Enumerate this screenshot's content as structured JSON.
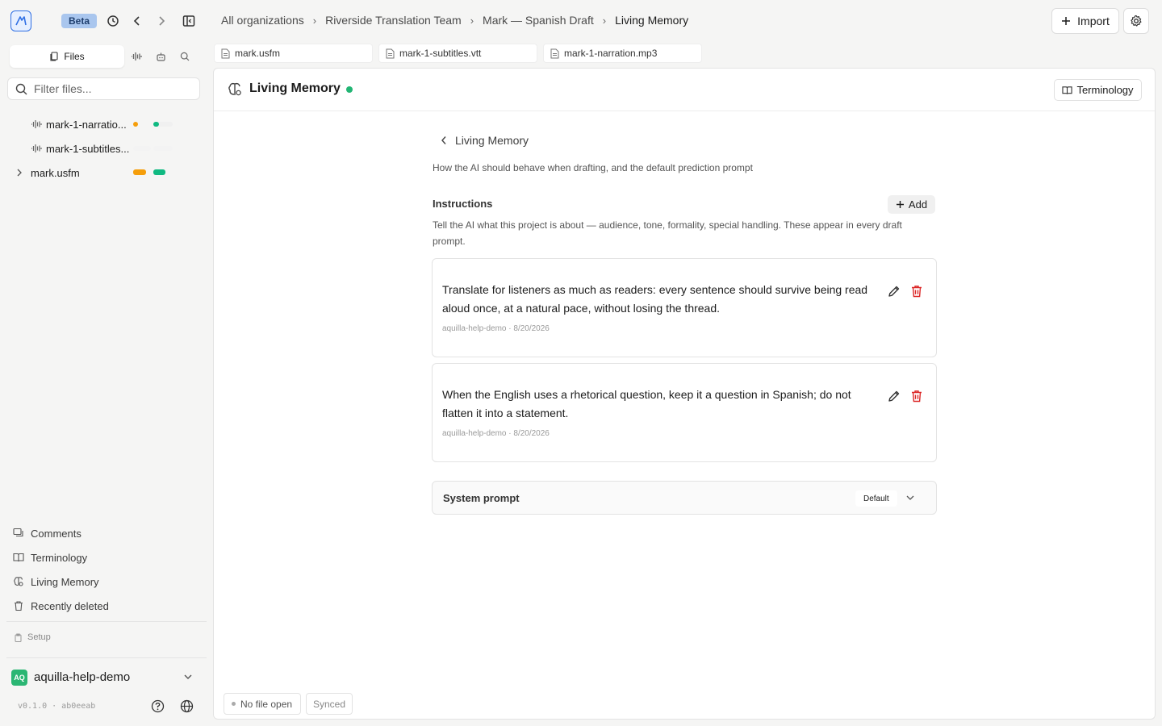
{
  "topbar": {
    "beta_label": "Beta",
    "breadcrumbs": [
      "All organizations",
      "Riverside Translation Team",
      "Mark — Spanish Draft",
      "Living Memory"
    ],
    "import_label": "Import"
  },
  "sidebar": {
    "tab_files": "Files",
    "filter_placeholder": "Filter files...",
    "files": [
      {
        "name": "mark-1-narratio...",
        "icon": "waveform-icon"
      },
      {
        "name": "mark-1-subtitles...",
        "icon": "waveform-icon"
      },
      {
        "name": "mark.usfm",
        "icon": "chevron-right-icon"
      }
    ],
    "nav": [
      {
        "label": "Comments",
        "icon": "comments-icon"
      },
      {
        "label": "Terminology",
        "icon": "book-icon"
      },
      {
        "label": "Living Memory",
        "icon": "brain-icon"
      },
      {
        "label": "Recently deleted",
        "icon": "trash-icon"
      }
    ],
    "setup_label": "Setup",
    "user": {
      "initials": "AQ",
      "name": "aquilla-help-demo"
    },
    "version": "v0.1.0 · ab0eeab"
  },
  "file_tabs": [
    "mark.usfm",
    "mark-1-subtitles.vtt",
    "mark-1-narration.mp3"
  ],
  "main": {
    "title": "Living Memory",
    "terminology_button": "Terminology",
    "back_label": "Living Memory",
    "description": "How the AI should behave when drafting, and the default prediction prompt",
    "instructions": {
      "title": "Instructions",
      "add_label": "Add",
      "help": "Tell the AI what this project is about — audience, tone, formality, special handling. These appear in every draft prompt.",
      "items": [
        {
          "text": "Translate for listeners as much as readers: every sentence should survive being read aloud once, at a natural pace, without losing the thread.",
          "meta": "aquilla-help-demo · 8/20/2026"
        },
        {
          "text": "When the English uses a rhetorical question, keep it a question in Spanish; do not flatten it into a statement.",
          "meta": "aquilla-help-demo · 8/20/2026"
        }
      ]
    },
    "system_prompt": {
      "label": "System prompt",
      "value": "Default"
    }
  },
  "status": {
    "file": "No file open",
    "sync": "Synced"
  },
  "colors": {
    "accent": "#2f6fe4",
    "green": "#22b574",
    "orange": "#f59e0b",
    "teal": "#10b981",
    "danger": "#dc2626"
  }
}
